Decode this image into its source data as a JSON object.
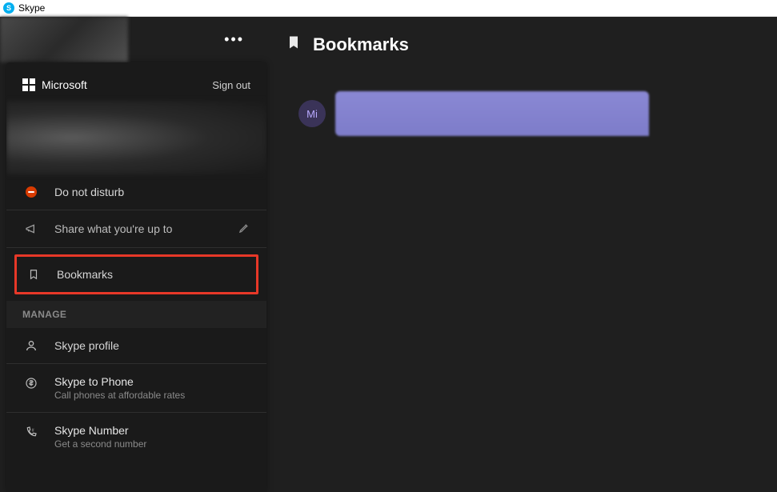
{
  "titlebar": {
    "app_name": "Skype"
  },
  "sidebar": {
    "brand": "Microsoft",
    "sign_out": "Sign out",
    "status": {
      "label": "Do not disturb"
    },
    "share": {
      "label": "Share what you're up to"
    },
    "bookmarks": {
      "label": "Bookmarks"
    },
    "manage_header": "MANAGE",
    "manage": [
      {
        "title": "Skype profile",
        "subtitle": ""
      },
      {
        "title": "Skype to Phone",
        "subtitle": "Call phones at affordable rates"
      },
      {
        "title": "Skype Number",
        "subtitle": "Get a second number"
      }
    ]
  },
  "main": {
    "title": "Bookmarks",
    "message": {
      "avatar_initials": "Mi"
    }
  }
}
